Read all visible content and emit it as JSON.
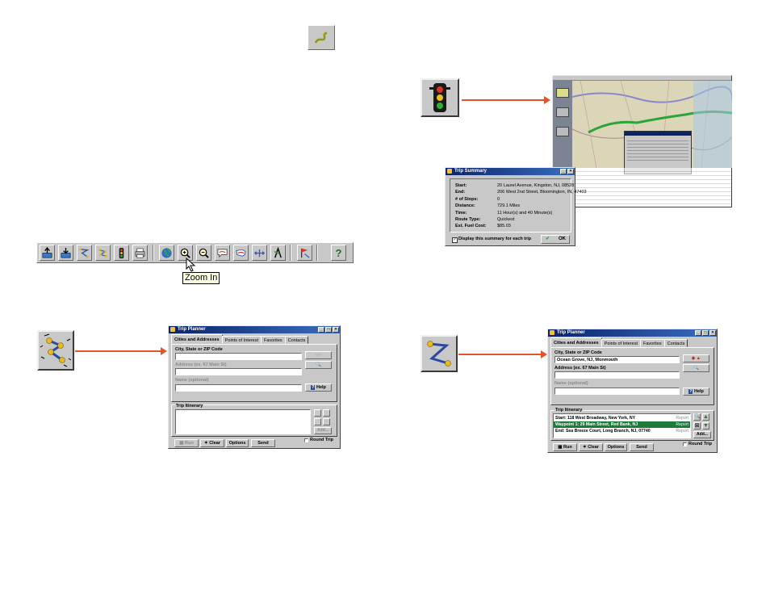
{
  "toolbar": {
    "tooltip": "Zoom In",
    "buttons": [
      "import-icon",
      "export-icon",
      "route-icon",
      "stops-icon",
      "traffic-light-icon",
      "print-icon",
      "globe-icon",
      "zoom-in-icon",
      "zoom-out-icon",
      "speech-map-icon",
      "usa-map-icon",
      "pan-icon",
      "route-tool-icon",
      "flag-icon",
      "help-icon"
    ],
    "help_glyph": "?"
  },
  "trip_summary": {
    "title": "Trip Summary",
    "rows": [
      {
        "label": "Start:",
        "value": "20 Laurel Avenue, Kingston, NJ, 08528"
      },
      {
        "label": "End:",
        "value": "206 West 2nd Street, Bloomington, IN, 47403"
      },
      {
        "label": "# of Stops:",
        "value": "0"
      },
      {
        "label": "Distance:",
        "value": "729.1 Miles"
      },
      {
        "label": "Time:",
        "value": "11 Hour(s) and 40 Minute(s)"
      },
      {
        "label": "Route Type:",
        "value": "Quickest"
      },
      {
        "label": "Est. Fuel Cost:",
        "value": "$85.03"
      }
    ],
    "checkbox_label": "Display this summary for each trip",
    "ok_label": "OK"
  },
  "trip_planner_empty": {
    "title": "Trip Planner",
    "tabs": [
      "Cities and Addresses",
      "Points of Interest",
      "Favorites",
      "Contacts"
    ],
    "city_label": "City, State or ZIP Code",
    "city_value": "",
    "address_label": "Address (ex. 67 Main St)",
    "address_value": "",
    "name_label": "Name (optional)",
    "name_value": "",
    "help_label": "Help",
    "itinerary_label": "Trip Itinerary",
    "add_label": "Add...",
    "run_label": "Run",
    "clear_label": "Clear",
    "options_label": "Options",
    "send_label": "Send",
    "round_trip_label": "Round Trip"
  },
  "trip_planner_filled": {
    "title": "Trip Planner",
    "tabs": [
      "Cities and Addresses",
      "Points of Interest",
      "Favorites",
      "Contacts"
    ],
    "city_label": "City, State or ZIP Code",
    "city_value": "Ocean Grove, NJ, Monmouth",
    "address_label": "Address (ex. 67 Main St)",
    "address_value": "",
    "name_label": "Name (optional)",
    "name_value": "",
    "help_label": "Help",
    "itinerary_label": "Trip Itinerary",
    "itinerary": [
      {
        "text": "Start: 118 West Broadway, New York, NY",
        "status": "Report",
        "selected": false
      },
      {
        "text": "Waypoint 1: 29 Main Street, Red Bank, NJ",
        "status": "Report",
        "selected": true
      },
      {
        "text": "End: Sea Breeze Court, Long Branch, NJ, 07740",
        "status": "Report",
        "selected": false
      }
    ],
    "add_label": "Add...",
    "run_label": "Run",
    "clear_label": "Clear",
    "options_label": "Options",
    "send_label": "Send",
    "round_trip_label": "Round Trip"
  },
  "colors": {
    "arrow": "#e2542a",
    "titlebar": "#0a246a",
    "selected_row": "#1f7a3a",
    "route": "#2da33a"
  }
}
